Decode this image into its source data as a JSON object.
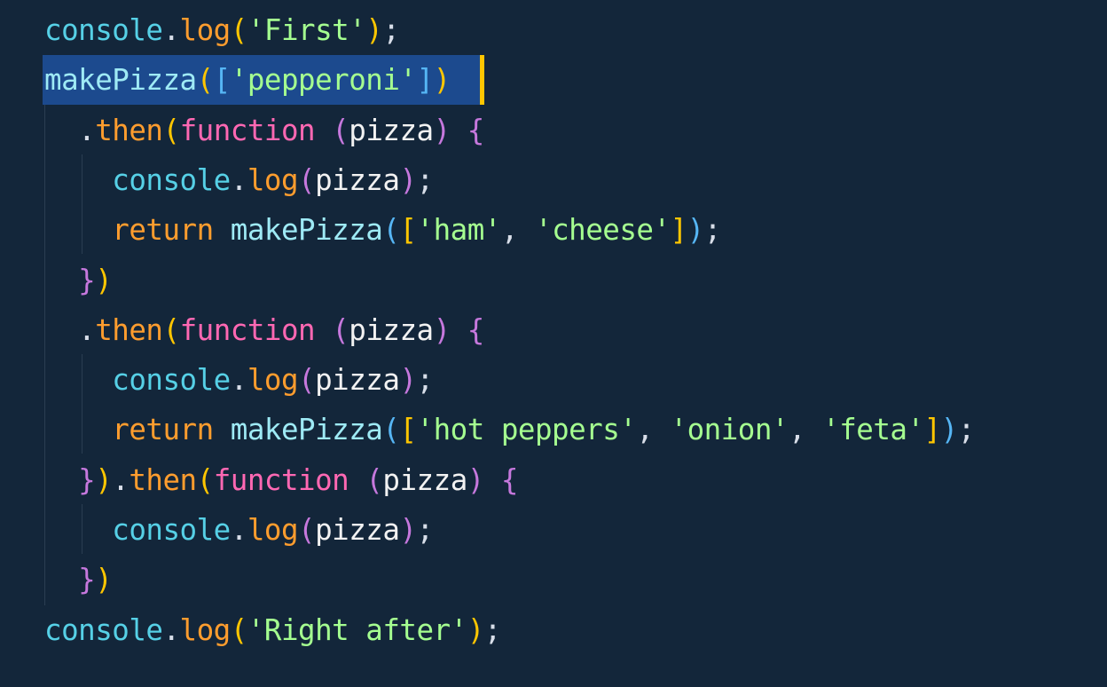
{
  "colors": {
    "background": "#13263a",
    "selection": "#1c4a8e",
    "cursor": "#ffc600",
    "indent_guide": "#2b3e52",
    "token": {
      "obj": "#56d0e6",
      "call": "#ff9d2e",
      "punc": "#d8dee9",
      "paren": "#ffc600",
      "paren2": "#56b6f5",
      "paren3": "#c678dd",
      "brace": "#c678dd",
      "str": "#a5ff90",
      "ident": "#f2f2f2",
      "kw": "#ff9d2e",
      "fn": "#ff68b3",
      "plain": "#9eeaf5"
    }
  },
  "code_lines": [
    {
      "tokens": [
        {
          "t": "console",
          "c": "obj"
        },
        {
          "t": ".",
          "c": "punc"
        },
        {
          "t": "log",
          "c": "call"
        },
        {
          "t": "(",
          "c": "paren"
        },
        {
          "t": "'First'",
          "c": "str"
        },
        {
          "t": ")",
          "c": "paren"
        },
        {
          "t": ";",
          "c": "punc"
        }
      ]
    },
    {
      "tokens": [
        {
          "t": "makePizza",
          "c": "plain"
        },
        {
          "t": "(",
          "c": "paren"
        },
        {
          "t": "[",
          "c": "paren2"
        },
        {
          "t": "'pepperoni'",
          "c": "str"
        },
        {
          "t": "]",
          "c": "paren2"
        },
        {
          "t": ")",
          "c": "paren"
        }
      ]
    },
    {
      "tokens": [
        {
          "t": "  .",
          "c": "punc"
        },
        {
          "t": "then",
          "c": "call"
        },
        {
          "t": "(",
          "c": "paren"
        },
        {
          "t": "function",
          "c": "fn"
        },
        {
          "t": " ",
          "c": "punc"
        },
        {
          "t": "(",
          "c": "paren3"
        },
        {
          "t": "pizza",
          "c": "ident"
        },
        {
          "t": ")",
          "c": "paren3"
        },
        {
          "t": " ",
          "c": "punc"
        },
        {
          "t": "{",
          "c": "brace"
        }
      ]
    },
    {
      "tokens": [
        {
          "t": "    console",
          "c": "obj"
        },
        {
          "t": ".",
          "c": "punc"
        },
        {
          "t": "log",
          "c": "call"
        },
        {
          "t": "(",
          "c": "paren3"
        },
        {
          "t": "pizza",
          "c": "ident"
        },
        {
          "t": ")",
          "c": "paren3"
        },
        {
          "t": ";",
          "c": "punc"
        }
      ]
    },
    {
      "tokens": [
        {
          "t": "    return",
          "c": "kw"
        },
        {
          "t": " ",
          "c": "punc"
        },
        {
          "t": "makePizza",
          "c": "plain"
        },
        {
          "t": "(",
          "c": "paren2"
        },
        {
          "t": "[",
          "c": "paren"
        },
        {
          "t": "'ham'",
          "c": "str"
        },
        {
          "t": ", ",
          "c": "punc"
        },
        {
          "t": "'cheese'",
          "c": "str"
        },
        {
          "t": "]",
          "c": "paren"
        },
        {
          "t": ")",
          "c": "paren2"
        },
        {
          "t": ";",
          "c": "punc"
        }
      ]
    },
    {
      "tokens": [
        {
          "t": "  }",
          "c": "brace"
        },
        {
          "t": ")",
          "c": "paren"
        }
      ]
    },
    {
      "tokens": [
        {
          "t": "  .",
          "c": "punc"
        },
        {
          "t": "then",
          "c": "call"
        },
        {
          "t": "(",
          "c": "paren"
        },
        {
          "t": "function",
          "c": "fn"
        },
        {
          "t": " ",
          "c": "punc"
        },
        {
          "t": "(",
          "c": "paren3"
        },
        {
          "t": "pizza",
          "c": "ident"
        },
        {
          "t": ")",
          "c": "paren3"
        },
        {
          "t": " ",
          "c": "punc"
        },
        {
          "t": "{",
          "c": "brace"
        }
      ]
    },
    {
      "tokens": [
        {
          "t": "    console",
          "c": "obj"
        },
        {
          "t": ".",
          "c": "punc"
        },
        {
          "t": "log",
          "c": "call"
        },
        {
          "t": "(",
          "c": "paren3"
        },
        {
          "t": "pizza",
          "c": "ident"
        },
        {
          "t": ")",
          "c": "paren3"
        },
        {
          "t": ";",
          "c": "punc"
        }
      ]
    },
    {
      "tokens": [
        {
          "t": "    return",
          "c": "kw"
        },
        {
          "t": " ",
          "c": "punc"
        },
        {
          "t": "makePizza",
          "c": "plain"
        },
        {
          "t": "(",
          "c": "paren2"
        },
        {
          "t": "[",
          "c": "paren"
        },
        {
          "t": "'hot peppers'",
          "c": "str"
        },
        {
          "t": ", ",
          "c": "punc"
        },
        {
          "t": "'onion'",
          "c": "str"
        },
        {
          "t": ", ",
          "c": "punc"
        },
        {
          "t": "'feta'",
          "c": "str"
        },
        {
          "t": "]",
          "c": "paren"
        },
        {
          "t": ")",
          "c": "paren2"
        },
        {
          "t": ";",
          "c": "punc"
        }
      ]
    },
    {
      "tokens": [
        {
          "t": "  }",
          "c": "brace"
        },
        {
          "t": ")",
          "c": "paren"
        },
        {
          "t": ".",
          "c": "punc"
        },
        {
          "t": "then",
          "c": "call"
        },
        {
          "t": "(",
          "c": "paren"
        },
        {
          "t": "function",
          "c": "fn"
        },
        {
          "t": " ",
          "c": "punc"
        },
        {
          "t": "(",
          "c": "paren3"
        },
        {
          "t": "pizza",
          "c": "ident"
        },
        {
          "t": ")",
          "c": "paren3"
        },
        {
          "t": " ",
          "c": "punc"
        },
        {
          "t": "{",
          "c": "brace"
        }
      ]
    },
    {
      "tokens": [
        {
          "t": "    console",
          "c": "obj"
        },
        {
          "t": ".",
          "c": "punc"
        },
        {
          "t": "log",
          "c": "call"
        },
        {
          "t": "(",
          "c": "paren3"
        },
        {
          "t": "pizza",
          "c": "ident"
        },
        {
          "t": ")",
          "c": "paren3"
        },
        {
          "t": ";",
          "c": "punc"
        }
      ]
    },
    {
      "tokens": [
        {
          "t": "  }",
          "c": "brace"
        },
        {
          "t": ")",
          "c": "paren"
        }
      ]
    },
    {
      "tokens": [
        {
          "t": "console",
          "c": "obj"
        },
        {
          "t": ".",
          "c": "punc"
        },
        {
          "t": "log",
          "c": "call"
        },
        {
          "t": "(",
          "c": "paren"
        },
        {
          "t": "'Right after'",
          "c": "str"
        },
        {
          "t": ")",
          "c": "paren"
        },
        {
          "t": ";",
          "c": "punc"
        }
      ]
    }
  ]
}
